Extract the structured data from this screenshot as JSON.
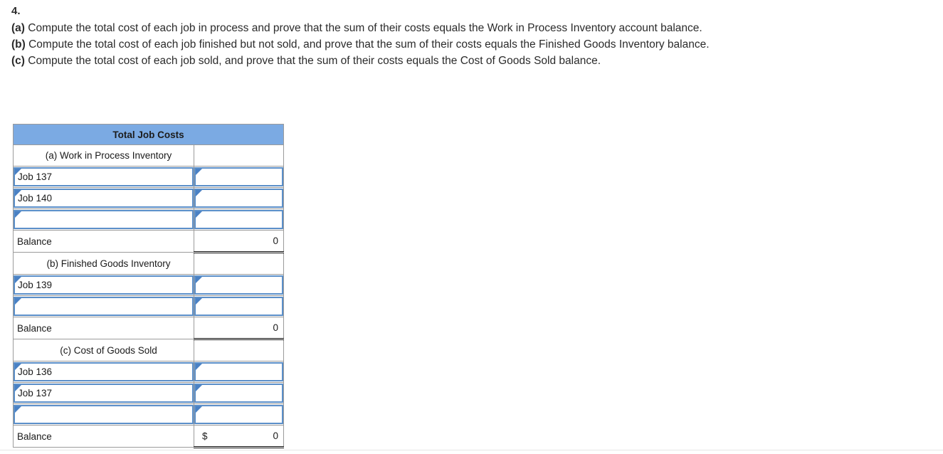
{
  "question": {
    "number": "4.",
    "lines": [
      {
        "label": "(a)",
        "text": " Compute the total cost of each job in process and prove that the sum of their costs equals the Work in Process Inventory account balance."
      },
      {
        "label": "(b)",
        "text": " Compute the total cost of each job finished but not sold, and prove that the sum of their costs equals the Finished Goods Inventory balance."
      },
      {
        "label": "(c)",
        "text": " Compute the total cost of each job sold, and prove that the sum of their costs equals the Cost of Goods Sold balance."
      }
    ]
  },
  "table": {
    "title": "Total Job Costs",
    "colors": {
      "header_fill": "#7BAAE3",
      "input_border": "#5b8fc9",
      "grid": "#9b9b9b"
    },
    "rows": [
      {
        "type": "section",
        "label": "(a) Work in Process Inventory",
        "value": ""
      },
      {
        "type": "input",
        "label": "Job 137",
        "value": ""
      },
      {
        "type": "input",
        "label": "Job 140",
        "value": ""
      },
      {
        "type": "input",
        "label": "",
        "value": ""
      },
      {
        "type": "balance",
        "label": "Balance",
        "currency": "",
        "value": "0"
      },
      {
        "type": "section",
        "label": "(b) Finished Goods Inventory",
        "value": ""
      },
      {
        "type": "input",
        "label": "Job 139",
        "value": ""
      },
      {
        "type": "input",
        "label": "",
        "value": ""
      },
      {
        "type": "balance",
        "label": "Balance",
        "currency": "",
        "value": "0"
      },
      {
        "type": "section",
        "label": "(c) Cost of Goods Sold",
        "value": ""
      },
      {
        "type": "input",
        "label": "Job 136",
        "value": ""
      },
      {
        "type": "input",
        "label": "Job 137",
        "value": ""
      },
      {
        "type": "input",
        "label": "",
        "value": ""
      },
      {
        "type": "balance",
        "label": "Balance",
        "currency": "$",
        "value": "0"
      }
    ]
  }
}
